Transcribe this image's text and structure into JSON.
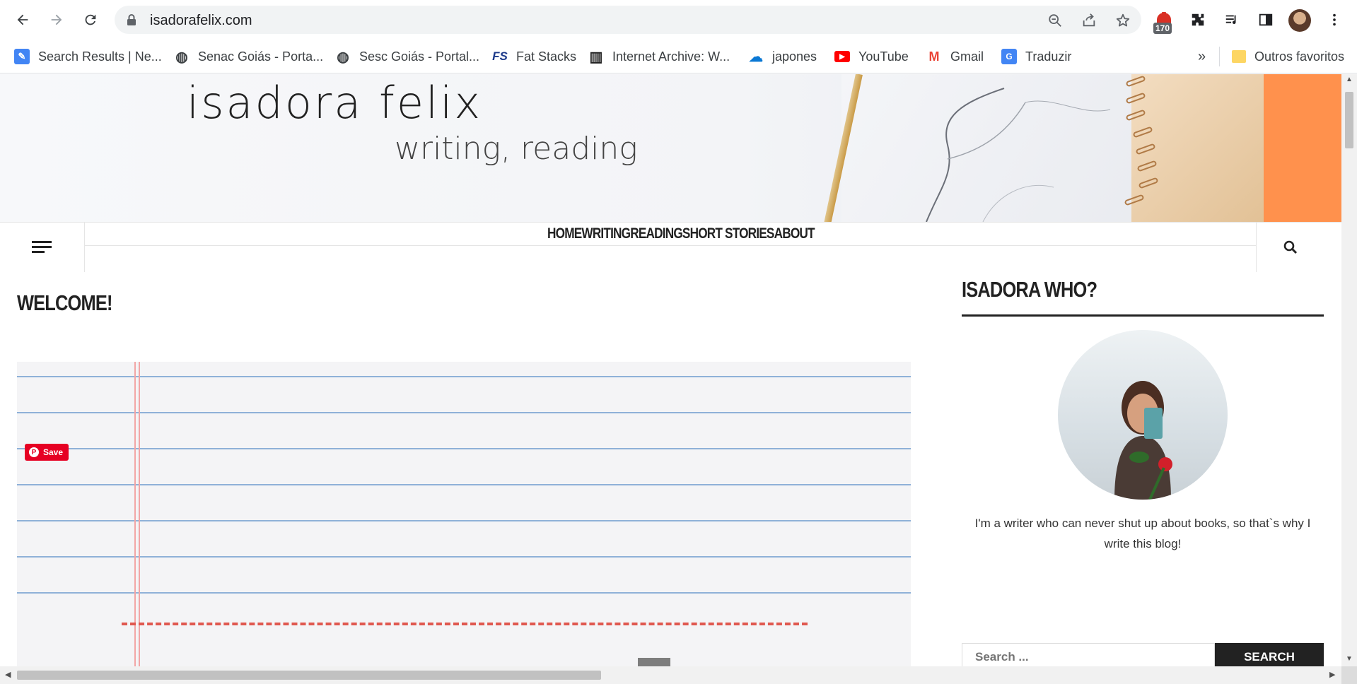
{
  "browser": {
    "url": "isadorafelix.com",
    "extension_badge": "170",
    "bookmarks": [
      {
        "label": "Search Results | Ne...",
        "icon": "edit-doc-icon",
        "color": "#4285f4"
      },
      {
        "label": "Senac Goiás - Porta...",
        "icon": "globe-icon",
        "color": "#3c4043"
      },
      {
        "label": "Sesc Goiás - Portal...",
        "icon": "globe-icon",
        "color": "#3c4043"
      },
      {
        "label": "Fat Stacks",
        "icon": "fs-icon",
        "color": "#1d3a8a"
      },
      {
        "label": "Internet Archive: W...",
        "icon": "archive-icon",
        "color": "#222222"
      },
      {
        "label": "japones",
        "icon": "onedrive-icon",
        "color": "#0a78d4"
      },
      {
        "label": "YouTube",
        "icon": "youtube-icon",
        "color": "#ff0000"
      },
      {
        "label": "Gmail",
        "icon": "gmail-icon",
        "color": "#ea4335"
      },
      {
        "label": "Traduzir",
        "icon": "translate-icon",
        "color": "#4285f4"
      }
    ],
    "overflow_label": "»",
    "other_bookmarks": "Outros favoritos"
  },
  "site": {
    "title": "isadora felix",
    "tagline": "writing, reading",
    "nav": [
      "HOME",
      "WRITING",
      "READING",
      "SHORT STORIES",
      "ABOUT"
    ],
    "post_title": "WELCOME!",
    "pin_save": "Save"
  },
  "sidebar": {
    "title": "ISADORA WHO?",
    "bio": "I'm a writer who can never shut up about books, so that`s why I write this blog!",
    "search_placeholder": "Search ...",
    "search_button": "SEARCH"
  },
  "colors": {
    "accent_orange": "#ff914d",
    "pinterest_red": "#e60023"
  }
}
